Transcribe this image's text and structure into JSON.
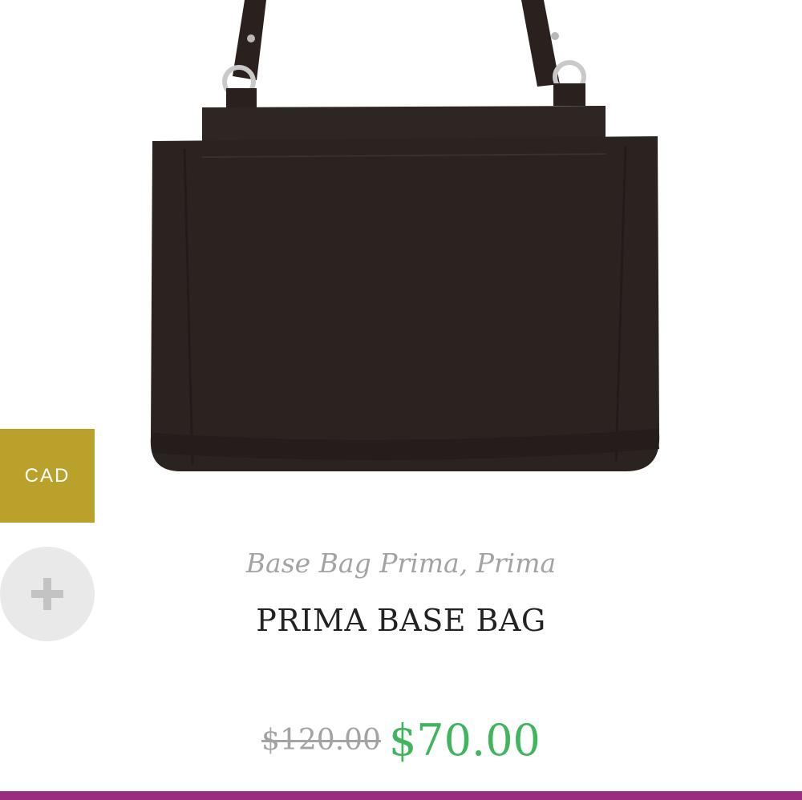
{
  "currency": {
    "label": "CAD"
  },
  "icons": {
    "add": "plus-icon",
    "product": "handbag-image"
  },
  "product": {
    "categories": [
      "Base Bag Prima",
      "Prima"
    ],
    "category_separator": ", ",
    "title": "PRIMA BASE BAG",
    "regular_price": "$120.00",
    "sale_price": "$70.00"
  },
  "colors": {
    "currency_tab": "#b9a12c",
    "sale_price": "#41b55d",
    "bottom_bar": "#9b2d7f"
  }
}
